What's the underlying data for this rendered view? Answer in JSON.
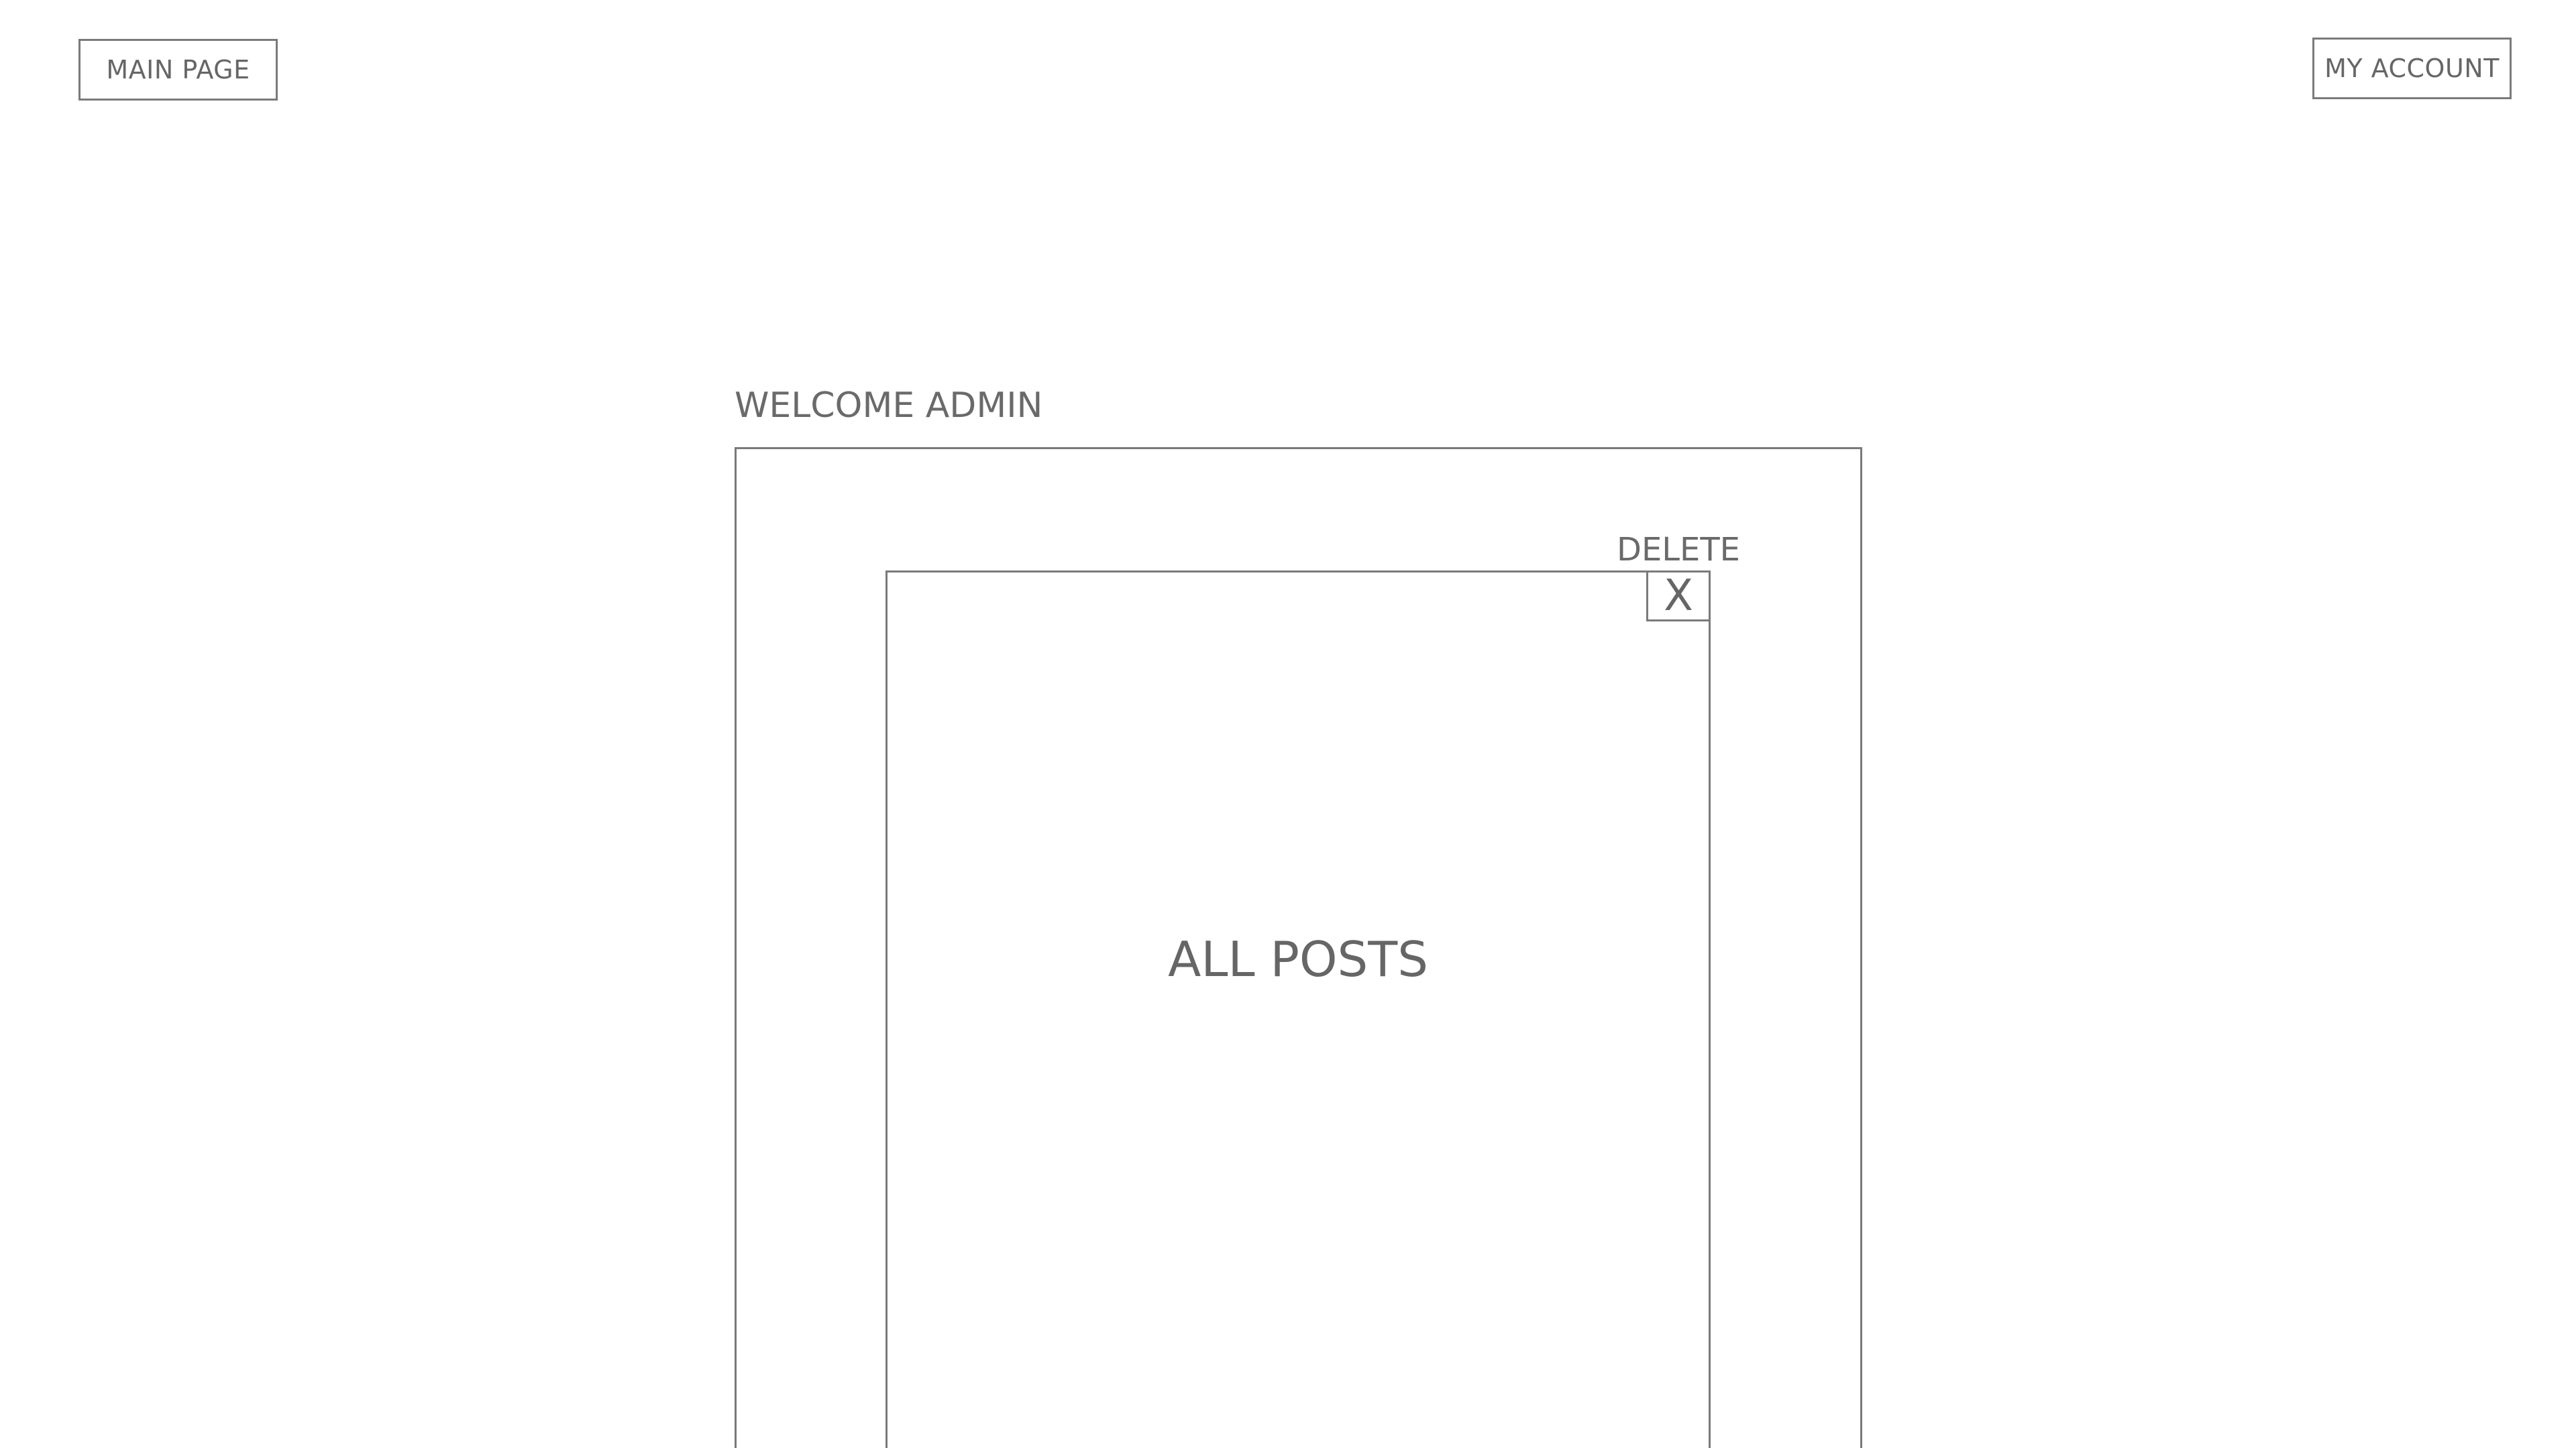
{
  "header": {
    "main_page_label": "MAIN PAGE",
    "my_account_label": "MY ACCOUNT"
  },
  "main": {
    "welcome_text": "WELCOME ADMIN",
    "posts_title": "ALL POSTS",
    "delete_label": "DELETE",
    "delete_icon_glyph": "X"
  },
  "icons": {
    "delete": "close-icon"
  },
  "colors": {
    "border": "#7a7a7a",
    "text": "#666666",
    "background": "#ffffff"
  }
}
